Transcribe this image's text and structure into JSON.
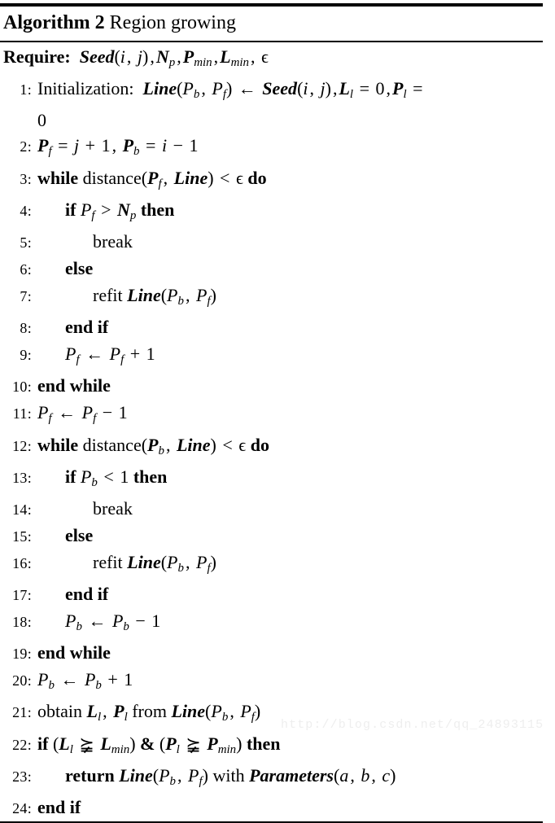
{
  "header": {
    "algorithm_word": "Algorithm",
    "algorithm_number": "2",
    "algorithm_name": "Region growing"
  },
  "require": {
    "keyword": "Require:",
    "text": "Seed(i, j), N_p, P_min, L_min, ϵ"
  },
  "lines": [
    {
      "no": "1:",
      "indent": 0,
      "text": "Initialization: Line(P_b, P_f) ← Seed(i, j), L_l = 0, P_l ="
    },
    {
      "no": "",
      "indent": 0,
      "text": "0",
      "continuation": true
    },
    {
      "no": "2:",
      "indent": 0,
      "text": "P_f = j + 1, P_b = i − 1"
    },
    {
      "no": "3:",
      "indent": 0,
      "text": "while distance(P_f, Line) < ϵ do"
    },
    {
      "no": "4:",
      "indent": 1,
      "text": "if P_f > N_p then"
    },
    {
      "no": "5:",
      "indent": 2,
      "text": "break"
    },
    {
      "no": "6:",
      "indent": 1,
      "text": "else"
    },
    {
      "no": "7:",
      "indent": 2,
      "text": "refit Line(P_b, P_f)"
    },
    {
      "no": "8:",
      "indent": 1,
      "text": "end if"
    },
    {
      "no": "9:",
      "indent": 1,
      "text": "P_f ← P_f + 1"
    },
    {
      "no": "10:",
      "indent": 0,
      "text": "end while"
    },
    {
      "no": "11:",
      "indent": 0,
      "text": "P_f ← P_f − 1"
    },
    {
      "no": "12:",
      "indent": 0,
      "text": "while distance(P_b, Line) < ϵ do"
    },
    {
      "no": "13:",
      "indent": 1,
      "text": "if P_b < 1 then"
    },
    {
      "no": "14:",
      "indent": 2,
      "text": "break"
    },
    {
      "no": "15:",
      "indent": 1,
      "text": "else"
    },
    {
      "no": "16:",
      "indent": 2,
      "text": "refit Line(P_b, P_f)"
    },
    {
      "no": "17:",
      "indent": 1,
      "text": "end if"
    },
    {
      "no": "18:",
      "indent": 1,
      "text": "P_b ← P_b − 1"
    },
    {
      "no": "19:",
      "indent": 0,
      "text": "end while"
    },
    {
      "no": "20:",
      "indent": 0,
      "text": "P_b ← P_b + 1"
    },
    {
      "no": "21:",
      "indent": 0,
      "text": "obtain L_l, P_l from Line(P_b, P_f)"
    },
    {
      "no": "22:",
      "indent": 0,
      "text": "if (L_l ⩾ L_min) & (P_l ⩾ P_min) then"
    },
    {
      "no": "23:",
      "indent": 1,
      "text": "return Line(P_b, P_f) with Parameters(a, b, c)"
    },
    {
      "no": "24:",
      "indent": 0,
      "text": "end if"
    }
  ],
  "watermark": {
    "text": "http://blog.csdn.net/qq_24893115"
  },
  "colors": {
    "rule": "#000000",
    "text": "#000000",
    "watermark": "#eeeeee"
  }
}
